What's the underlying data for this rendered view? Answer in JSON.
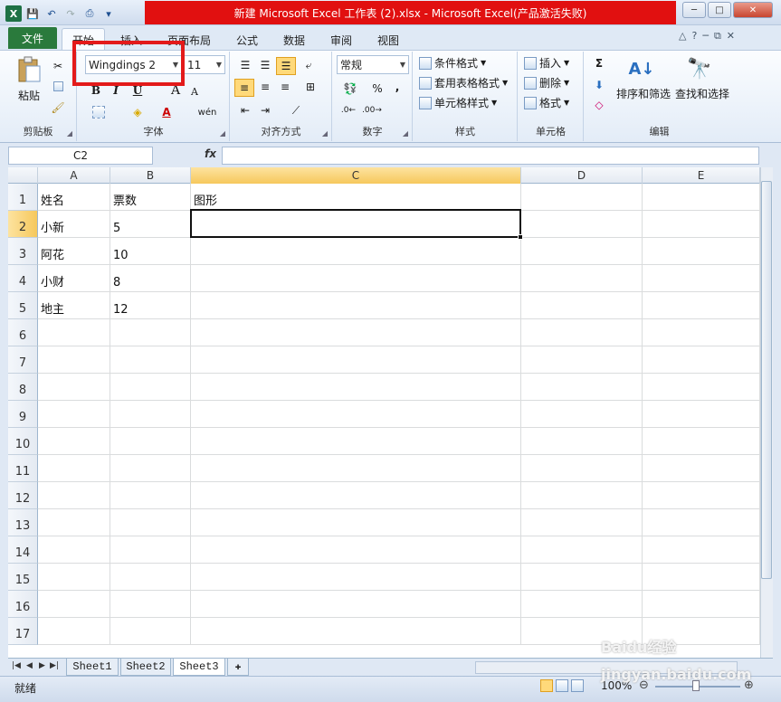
{
  "window": {
    "title": "新建 Microsoft Excel 工作表 (2).xlsx - Microsoft Excel(产品激活失败)",
    "controls": {
      "minimize": "─",
      "maximize": "□",
      "close": "✕"
    }
  },
  "quick_access": {
    "app_icon": "X",
    "save": "💾",
    "undo": "↶",
    "redo": "↷",
    "preview": "⎙",
    "customize": "▾"
  },
  "tabs": {
    "file": "文件",
    "items": [
      "开始",
      "插入",
      "页面布局",
      "公式",
      "数据",
      "审阅",
      "视图"
    ]
  },
  "ribbon_right": {
    "minimize": "△",
    "help": "?",
    "min": "─",
    "restore": "⧉",
    "close": "✕"
  },
  "ribbon": {
    "clipboard": {
      "paste": "粘贴",
      "label": "剪贴板"
    },
    "font": {
      "name": "Wingdings 2",
      "size": "11",
      "bold": "B",
      "italic": "I",
      "underline": "U",
      "grow": "A",
      "shrink": "A",
      "wen": "wén",
      "label": "字体"
    },
    "alignment": {
      "label": "对齐方式"
    },
    "number": {
      "format": "常规",
      "percent": "%",
      "comma": ",",
      "label": "数字"
    },
    "styles": {
      "conditional": "条件格式",
      "table": "套用表格格式",
      "cell": "单元格样式",
      "label": "样式"
    },
    "cells": {
      "insert": "插入",
      "delete": "删除",
      "format": "格式",
      "label": "单元格"
    },
    "editing": {
      "sum": "Σ",
      "sort": "排序和筛选",
      "find": "查找和选择",
      "label": "编辑"
    }
  },
  "formula_bar": {
    "namebox": "C2",
    "fx": "fx",
    "value": ""
  },
  "grid": {
    "columns": [
      "A",
      "B",
      "C",
      "D",
      "E"
    ],
    "rows": [
      "1",
      "2",
      "3",
      "4",
      "5",
      "6",
      "7",
      "8",
      "9",
      "10",
      "11",
      "12",
      "13",
      "14",
      "15",
      "16",
      "17"
    ],
    "cells": [
      [
        "姓名",
        "票数",
        "图形"
      ],
      [
        "小新",
        "5",
        ""
      ],
      [
        "阿花",
        "10",
        ""
      ],
      [
        "小财",
        "8",
        ""
      ],
      [
        "地主",
        "12",
        ""
      ]
    ],
    "selected_cell": "C2"
  },
  "sheets": {
    "tabs": [
      "Sheet1",
      "Sheet2",
      "Sheet3"
    ],
    "active": "Sheet3"
  },
  "status": {
    "mode": "就绪",
    "zoom": "100%"
  },
  "watermark": "Baidu经验 jingyan.baidu.com"
}
